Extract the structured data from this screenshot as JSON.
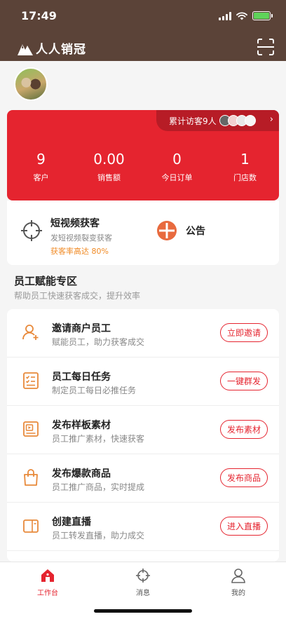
{
  "status_bar": {
    "time": "17:49"
  },
  "header": {
    "logo_text": "人人销冠",
    "scan_icon": "scan-icon"
  },
  "stats": {
    "visitors_label": "累计访客9人",
    "items": [
      {
        "value": "9",
        "label": "客户"
      },
      {
        "value": "0.00",
        "label": "销售额"
      },
      {
        "value": "0",
        "label": "今日订单"
      },
      {
        "value": "1",
        "label": "门店数"
      }
    ]
  },
  "promo": {
    "video": {
      "title": "短视频获客",
      "subtitle": "发短视频裂变获客",
      "rate": "获客率高达 80%"
    },
    "notice": {
      "title": "公告"
    }
  },
  "section": {
    "title": "员工赋能专区",
    "subtitle": "帮助员工快速获客成交，提升效率"
  },
  "tasks": [
    {
      "icon": "add-user-icon",
      "title": "邀请商户员工",
      "subtitle": "赋能员工，助力获客成交",
      "button": "立即邀请"
    },
    {
      "icon": "checklist-icon",
      "title": "员工每日任务",
      "subtitle": "制定员工每日必推任务",
      "button": "一键群发"
    },
    {
      "icon": "media-icon",
      "title": "发布样板素材",
      "subtitle": "员工推广素材，快速获客",
      "button": "发布素材"
    },
    {
      "icon": "shopping-bag-icon",
      "title": "发布爆款商品",
      "subtitle": "员工推广商品，实时提成",
      "button": "发布商品"
    },
    {
      "icon": "live-icon",
      "title": "创建直播",
      "subtitle": "员工转发直播，助力成交",
      "button": "进入直播"
    }
  ],
  "tabbar": [
    {
      "label": "工作台",
      "icon": "home-icon",
      "active": true
    },
    {
      "label": "消息",
      "icon": "target-icon",
      "active": false
    },
    {
      "label": "我的",
      "icon": "user-icon",
      "active": false
    }
  ],
  "colors": {
    "brand_brown": "#5b4338",
    "primary_red": "#e5242f",
    "accent_orange": "#f08a24"
  }
}
